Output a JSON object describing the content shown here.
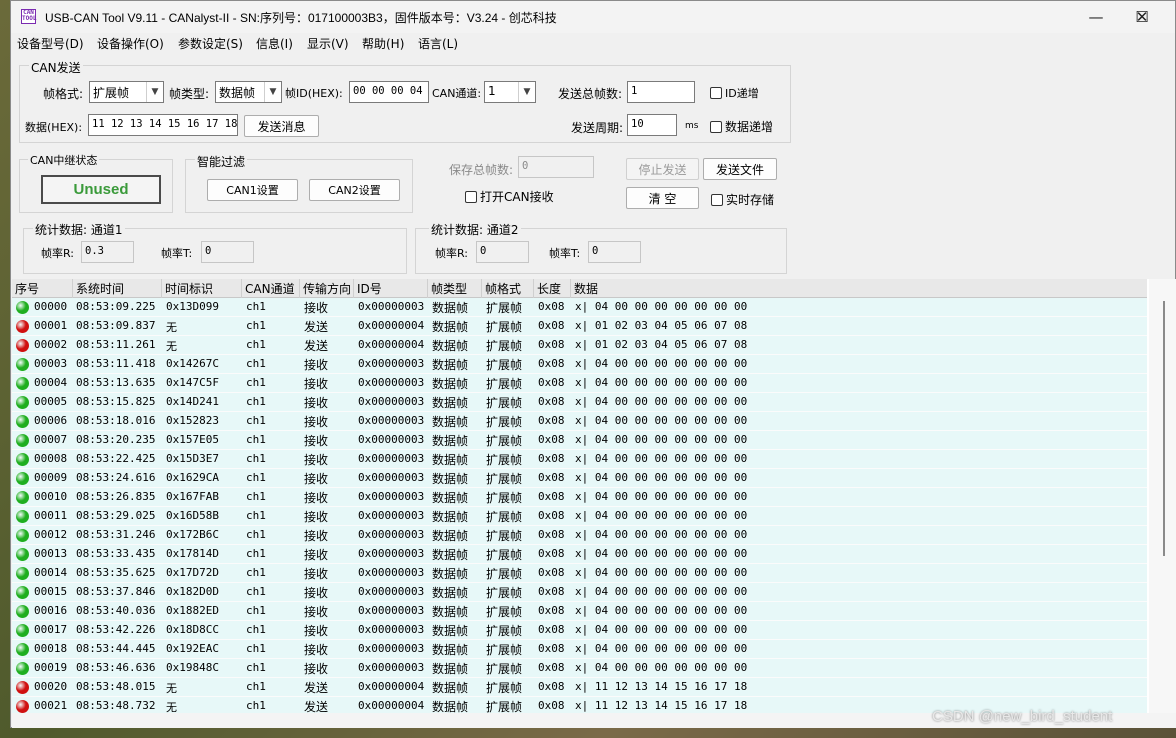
{
  "window": {
    "icon_text": "CAN TOOL",
    "title": "USB-CAN Tool V9.11 - CANalyst-II - SN:序列号：017100003B3，固件版本号：V3.24 - 创芯科技",
    "controls": {
      "minimize": "—",
      "maximize": "☐",
      "close": "✕"
    }
  },
  "menu": [
    "设备型号(D)",
    "设备操作(O)",
    "参数设定(S)",
    "信息(I)",
    "显示(V)",
    "帮助(H)",
    "语言(L)"
  ],
  "can_send": {
    "group_title": "CAN发送",
    "frame_format_label": "帧格式:",
    "frame_format_value": "扩展帧",
    "frame_type_label": "帧类型:",
    "frame_type_value": "数据帧",
    "frame_id_label": "帧ID(HEX):",
    "frame_id_value": "00 00 00 04",
    "channel_label": "CAN通道:",
    "channel_value": "1",
    "total_frames_label": "发送总帧数:",
    "total_frames_value": "1",
    "id_increment_label": "ID递增",
    "data_label": "数据(HEX):",
    "data_value": "11 12 13 14 15 16 17 18",
    "send_message_button": "发送消息",
    "send_period_label": "发送周期:",
    "send_period_value": "10",
    "send_period_unit": "ms",
    "data_increment_label": "数据递增"
  },
  "relay": {
    "group_title": "CAN中继状态",
    "status": "Unused"
  },
  "filter": {
    "group_title": "智能过滤",
    "can1_button": "CAN1设置",
    "can2_button": "CAN2设置"
  },
  "save": {
    "total_saved_label": "保存总帧数:",
    "total_saved_value": "0",
    "stop_send_button": "停止发送",
    "send_file_button": "发送文件",
    "open_receive_label": "打开CAN接收",
    "clear_button": "清 空",
    "realtime_save_label": "实时存储"
  },
  "stats1": {
    "group_title": "统计数据: 通道1",
    "rate_r_label": "帧率R:",
    "rate_r_value": "0.3",
    "rate_t_label": "帧率T:",
    "rate_t_value": "0"
  },
  "stats2": {
    "group_title": "统计数据: 通道2",
    "rate_r_label": "帧率R:",
    "rate_r_value": "0",
    "rate_t_label": "帧率T:",
    "rate_t_value": "0"
  },
  "colors": {
    "receive_dot": "#1fae1f",
    "send_dot": "#d01010",
    "row_bg": "#e7f8f8"
  },
  "table": {
    "columns": [
      "序号",
      "系统时间",
      "时间标识",
      "CAN通道",
      "传输方向",
      "ID号",
      "帧类型",
      "帧格式",
      "长度",
      "数据"
    ],
    "rows": [
      {
        "status": "receive",
        "seq": "00000",
        "time": "08:53:09.225",
        "stamp": "0x13D099",
        "ch": "ch1",
        "dir": "接收",
        "id": "0x00000003",
        "type": "数据帧",
        "format": "扩展帧",
        "len": "0x08",
        "data": "x| 04 00 00 00 00 00 00 00"
      },
      {
        "status": "send",
        "seq": "00001",
        "time": "08:53:09.837",
        "stamp": "无",
        "ch": "ch1",
        "dir": "发送",
        "id": "0x00000004",
        "type": "数据帧",
        "format": "扩展帧",
        "len": "0x08",
        "data": "x| 01 02 03 04 05 06 07 08"
      },
      {
        "status": "send",
        "seq": "00002",
        "time": "08:53:11.261",
        "stamp": "无",
        "ch": "ch1",
        "dir": "发送",
        "id": "0x00000004",
        "type": "数据帧",
        "format": "扩展帧",
        "len": "0x08",
        "data": "x| 01 02 03 04 05 06 07 08"
      },
      {
        "status": "receive",
        "seq": "00003",
        "time": "08:53:11.418",
        "stamp": "0x14267C",
        "ch": "ch1",
        "dir": "接收",
        "id": "0x00000003",
        "type": "数据帧",
        "format": "扩展帧",
        "len": "0x08",
        "data": "x| 04 00 00 00 00 00 00 00"
      },
      {
        "status": "receive",
        "seq": "00004",
        "time": "08:53:13.635",
        "stamp": "0x147C5F",
        "ch": "ch1",
        "dir": "接收",
        "id": "0x00000003",
        "type": "数据帧",
        "format": "扩展帧",
        "len": "0x08",
        "data": "x| 04 00 00 00 00 00 00 00"
      },
      {
        "status": "receive",
        "seq": "00005",
        "time": "08:53:15.825",
        "stamp": "0x14D241",
        "ch": "ch1",
        "dir": "接收",
        "id": "0x00000003",
        "type": "数据帧",
        "format": "扩展帧",
        "len": "0x08",
        "data": "x| 04 00 00 00 00 00 00 00"
      },
      {
        "status": "receive",
        "seq": "00006",
        "time": "08:53:18.016",
        "stamp": "0x152823",
        "ch": "ch1",
        "dir": "接收",
        "id": "0x00000003",
        "type": "数据帧",
        "format": "扩展帧",
        "len": "0x08",
        "data": "x| 04 00 00 00 00 00 00 00"
      },
      {
        "status": "receive",
        "seq": "00007",
        "time": "08:53:20.235",
        "stamp": "0x157E05",
        "ch": "ch1",
        "dir": "接收",
        "id": "0x00000003",
        "type": "数据帧",
        "format": "扩展帧",
        "len": "0x08",
        "data": "x| 04 00 00 00 00 00 00 00"
      },
      {
        "status": "receive",
        "seq": "00008",
        "time": "08:53:22.425",
        "stamp": "0x15D3E7",
        "ch": "ch1",
        "dir": "接收",
        "id": "0x00000003",
        "type": "数据帧",
        "format": "扩展帧",
        "len": "0x08",
        "data": "x| 04 00 00 00 00 00 00 00"
      },
      {
        "status": "receive",
        "seq": "00009",
        "time": "08:53:24.616",
        "stamp": "0x1629CA",
        "ch": "ch1",
        "dir": "接收",
        "id": "0x00000003",
        "type": "数据帧",
        "format": "扩展帧",
        "len": "0x08",
        "data": "x| 04 00 00 00 00 00 00 00"
      },
      {
        "status": "receive",
        "seq": "00010",
        "time": "08:53:26.835",
        "stamp": "0x167FAB",
        "ch": "ch1",
        "dir": "接收",
        "id": "0x00000003",
        "type": "数据帧",
        "format": "扩展帧",
        "len": "0x08",
        "data": "x| 04 00 00 00 00 00 00 00"
      },
      {
        "status": "receive",
        "seq": "00011",
        "time": "08:53:29.025",
        "stamp": "0x16D58B",
        "ch": "ch1",
        "dir": "接收",
        "id": "0x00000003",
        "type": "数据帧",
        "format": "扩展帧",
        "len": "0x08",
        "data": "x| 04 00 00 00 00 00 00 00"
      },
      {
        "status": "receive",
        "seq": "00012",
        "time": "08:53:31.246",
        "stamp": "0x172B6C",
        "ch": "ch1",
        "dir": "接收",
        "id": "0x00000003",
        "type": "数据帧",
        "format": "扩展帧",
        "len": "0x08",
        "data": "x| 04 00 00 00 00 00 00 00"
      },
      {
        "status": "receive",
        "seq": "00013",
        "time": "08:53:33.435",
        "stamp": "0x17814D",
        "ch": "ch1",
        "dir": "接收",
        "id": "0x00000003",
        "type": "数据帧",
        "format": "扩展帧",
        "len": "0x08",
        "data": "x| 04 00 00 00 00 00 00 00"
      },
      {
        "status": "receive",
        "seq": "00014",
        "time": "08:53:35.625",
        "stamp": "0x17D72D",
        "ch": "ch1",
        "dir": "接收",
        "id": "0x00000003",
        "type": "数据帧",
        "format": "扩展帧",
        "len": "0x08",
        "data": "x| 04 00 00 00 00 00 00 00"
      },
      {
        "status": "receive",
        "seq": "00015",
        "time": "08:53:37.846",
        "stamp": "0x182D0D",
        "ch": "ch1",
        "dir": "接收",
        "id": "0x00000003",
        "type": "数据帧",
        "format": "扩展帧",
        "len": "0x08",
        "data": "x| 04 00 00 00 00 00 00 00"
      },
      {
        "status": "receive",
        "seq": "00016",
        "time": "08:53:40.036",
        "stamp": "0x1882ED",
        "ch": "ch1",
        "dir": "接收",
        "id": "0x00000003",
        "type": "数据帧",
        "format": "扩展帧",
        "len": "0x08",
        "data": "x| 04 00 00 00 00 00 00 00"
      },
      {
        "status": "receive",
        "seq": "00017",
        "time": "08:53:42.226",
        "stamp": "0x18D8CC",
        "ch": "ch1",
        "dir": "接收",
        "id": "0x00000003",
        "type": "数据帧",
        "format": "扩展帧",
        "len": "0x08",
        "data": "x| 04 00 00 00 00 00 00 00"
      },
      {
        "status": "receive",
        "seq": "00018",
        "time": "08:53:44.445",
        "stamp": "0x192EAC",
        "ch": "ch1",
        "dir": "接收",
        "id": "0x00000003",
        "type": "数据帧",
        "format": "扩展帧",
        "len": "0x08",
        "data": "x| 04 00 00 00 00 00 00 00"
      },
      {
        "status": "receive",
        "seq": "00019",
        "time": "08:53:46.636",
        "stamp": "0x19848C",
        "ch": "ch1",
        "dir": "接收",
        "id": "0x00000003",
        "type": "数据帧",
        "format": "扩展帧",
        "len": "0x08",
        "data": "x| 04 00 00 00 00 00 00 00"
      },
      {
        "status": "send",
        "seq": "00020",
        "time": "08:53:48.015",
        "stamp": "无",
        "ch": "ch1",
        "dir": "发送",
        "id": "0x00000004",
        "type": "数据帧",
        "format": "扩展帧",
        "len": "0x08",
        "data": "x| 11 12 13 14 15 16 17 18"
      },
      {
        "status": "send",
        "seq": "00021",
        "time": "08:53:48.732",
        "stamp": "无",
        "ch": "ch1",
        "dir": "发送",
        "id": "0x00000004",
        "type": "数据帧",
        "format": "扩展帧",
        "len": "0x08",
        "data": "x| 11 12 13 14 15 16 17 18"
      }
    ]
  },
  "watermark": "CSDN @new_bird_student"
}
